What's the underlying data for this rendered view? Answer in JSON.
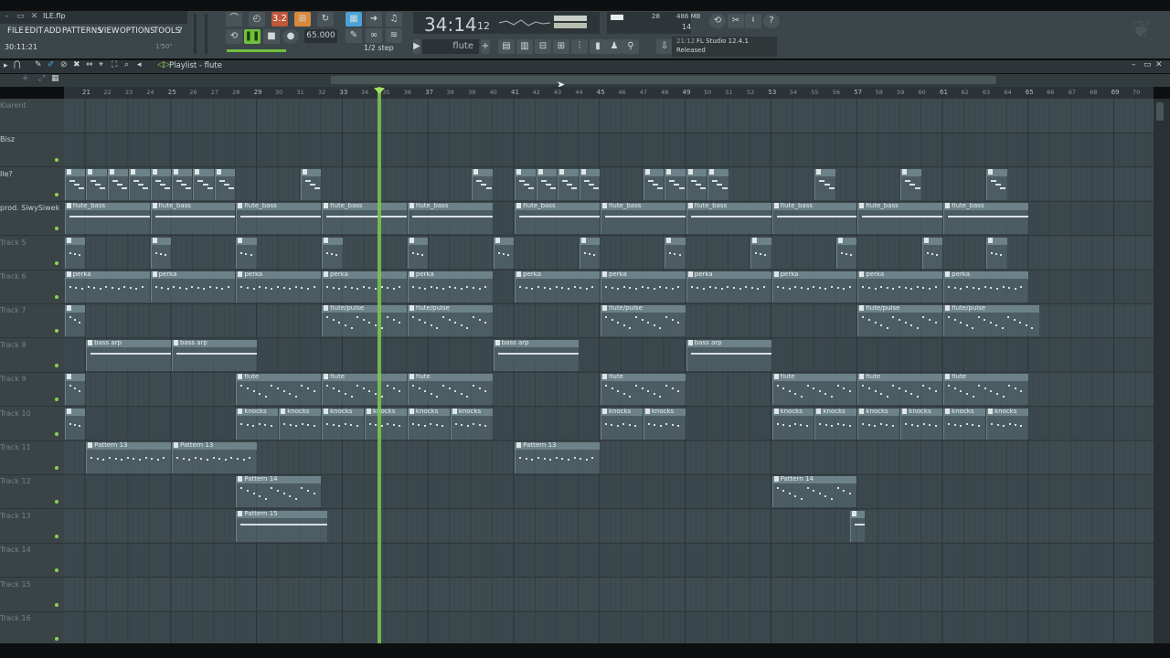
{
  "window": {
    "file_name": "ILE.flp",
    "clock": "30:11:21",
    "clock_sub": "1'50\""
  },
  "menu": [
    "FILE",
    "EDIT",
    "ADD",
    "PATTERNS",
    "VIEW",
    "OPTIONS",
    "TOOLS",
    "?"
  ],
  "transport": {
    "time_main": "34:14",
    "time_sub": "12",
    "tempo": "65.000",
    "step": "1/2 step",
    "pattern": "flute"
  },
  "monitor": {
    "cpu": "28",
    "memory": "486 MB",
    "polyphony": "14"
  },
  "news": {
    "date": "21:12",
    "title": "FL Studio 12.4.1",
    "status": "Released"
  },
  "playlist": {
    "title": "Playlist - flute"
  },
  "ruler": [
    "21",
    "22",
    "23",
    "24",
    "25",
    "26",
    "27",
    "28",
    "29",
    "30",
    "31",
    "32",
    "33",
    "34",
    "35",
    "36",
    "37",
    "38",
    "39",
    "40",
    "41",
    "42",
    "43",
    "44",
    "45",
    "46",
    "47",
    "48",
    "49",
    "50",
    "51",
    "52",
    "53",
    "54",
    "55",
    "56",
    "57",
    "58",
    "59",
    "60",
    "61",
    "62",
    "63",
    "64",
    "65",
    "66",
    "67",
    "68",
    "69",
    "70"
  ],
  "tracks": [
    "Klarent",
    "Bisz",
    "Ile?",
    "prod. SiwySiwek",
    "Track 5",
    "Track 6",
    "Track 7",
    "Track 8",
    "Track 9",
    "Track 10",
    "Track 11",
    "Track 12",
    "Track 13",
    "Track 14",
    "Track 15",
    "Track 16"
  ],
  "clip_labels": {
    "flute_bass": "flute_bass",
    "perka": "perka",
    "flute_pulse": "flute/pulse",
    "bass_arp": "bass arp",
    "flute": "flute",
    "knocks": "knocks",
    "pattern13": "Pattern 13",
    "pattern14": "Pattern 14",
    "pattern15": "Pattern 15"
  },
  "colors": {
    "accent": "#7ec94e",
    "grid": "#3d4a4f",
    "clip": "#6c8288"
  }
}
